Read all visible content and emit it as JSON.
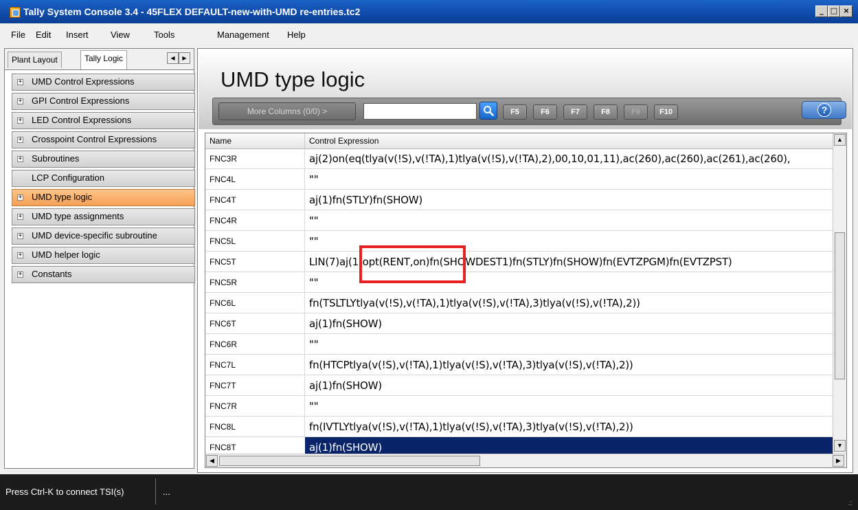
{
  "window": {
    "title": "Tally System Console 3.4 - 45FLEX DEFAULT-new-with-UMD re-entries.tc2",
    "min_glyph": "_",
    "max_glyph": "□",
    "close_glyph": "×"
  },
  "menu": [
    "File",
    "Edit",
    "Insert",
    "View",
    "Tools",
    "Management",
    "Help"
  ],
  "left": {
    "tabs": [
      "Plant Layout",
      "Tally Logic"
    ],
    "active_tab": "Tally Logic",
    "arrow_left": "◀",
    "arrow_right": "▶",
    "tree": [
      {
        "label": "UMD Control Expressions",
        "expand": "+"
      },
      {
        "label": "GPI Control Expressions",
        "expand": "+"
      },
      {
        "label": "LED Control Expressions",
        "expand": "+"
      },
      {
        "label": "Crosspoint Control Expressions",
        "expand": "+"
      },
      {
        "label": "Subroutines",
        "expand": "+"
      },
      {
        "label": "LCP Configuration",
        "expand": ""
      },
      {
        "label": "UMD type logic",
        "expand": "+",
        "selected": true
      },
      {
        "label": "UMD type assignments",
        "expand": "+"
      },
      {
        "label": "UMD device-specific subroutine",
        "expand": "+"
      },
      {
        "label": "UMD helper logic",
        "expand": "+"
      },
      {
        "label": "Constants",
        "expand": "+"
      }
    ]
  },
  "main": {
    "page_title": "UMD type logic",
    "more_columns": "More Columns (0/0) >",
    "search_value": "",
    "fkeys": [
      {
        "label": "F5",
        "enabled": true
      },
      {
        "label": "F6",
        "enabled": true
      },
      {
        "label": "F7",
        "enabled": true
      },
      {
        "label": "F8",
        "enabled": true
      },
      {
        "label": "F9",
        "enabled": false
      },
      {
        "label": "F10",
        "enabled": true
      }
    ],
    "help_glyph": "?",
    "grid": {
      "columns": [
        "Name",
        "Control Expression"
      ],
      "rows": [
        {
          "name": "FNC3R",
          "expr": "aj(2)on(eq(tlya(v(!S),v(!TA),1)tlya(v(!S),v(!TA),2),00,10,01,11),ac(260),ac(260),ac(261),ac(260),"
        },
        {
          "name": "FNC4L",
          "expr": "\"\""
        },
        {
          "name": "FNC4T",
          "expr": "aj(1)fn(STLY)fn(SHOW)"
        },
        {
          "name": "FNC4R",
          "expr": "\"\""
        },
        {
          "name": "FNC5L",
          "expr": "\"\""
        },
        {
          "name": "FNC5T",
          "expr": "LIN(7)aj(1)opt(RENT,on)fn(SHOWDEST1)fn(STLY)fn(SHOW)fn(EVTZPGM)fn(EVTZPST)"
        },
        {
          "name": "FNC5R",
          "expr": "\"\""
        },
        {
          "name": "FNC6L",
          "expr": "fn(TSLTLYtlya(v(!S),v(!TA),1)tlya(v(!S),v(!TA),3)tlya(v(!S),v(!TA),2))"
        },
        {
          "name": "FNC6T",
          "expr": "aj(1)fn(SHOW)"
        },
        {
          "name": "FNC6R",
          "expr": "\"\""
        },
        {
          "name": "FNC7L",
          "expr": "fn(HTCPtlya(v(!S),v(!TA),1)tlya(v(!S),v(!TA),3)tlya(v(!S),v(!TA),2))"
        },
        {
          "name": "FNC7T",
          "expr": "aj(1)fn(SHOW)"
        },
        {
          "name": "FNC7R",
          "expr": "\"\""
        },
        {
          "name": "FNC8L",
          "expr": "fn(IVTLYtlya(v(!S),v(!TA),1)tlya(v(!S),v(!TA),3)tlya(v(!S),v(!TA),2))"
        },
        {
          "name": "FNC8T",
          "expr": "aj(1)fn(SHOW)",
          "selected": true
        }
      ]
    }
  },
  "status": {
    "text": "Press Ctrl-K to connect TSI(s)",
    "more": "...",
    "grip": ".:"
  }
}
